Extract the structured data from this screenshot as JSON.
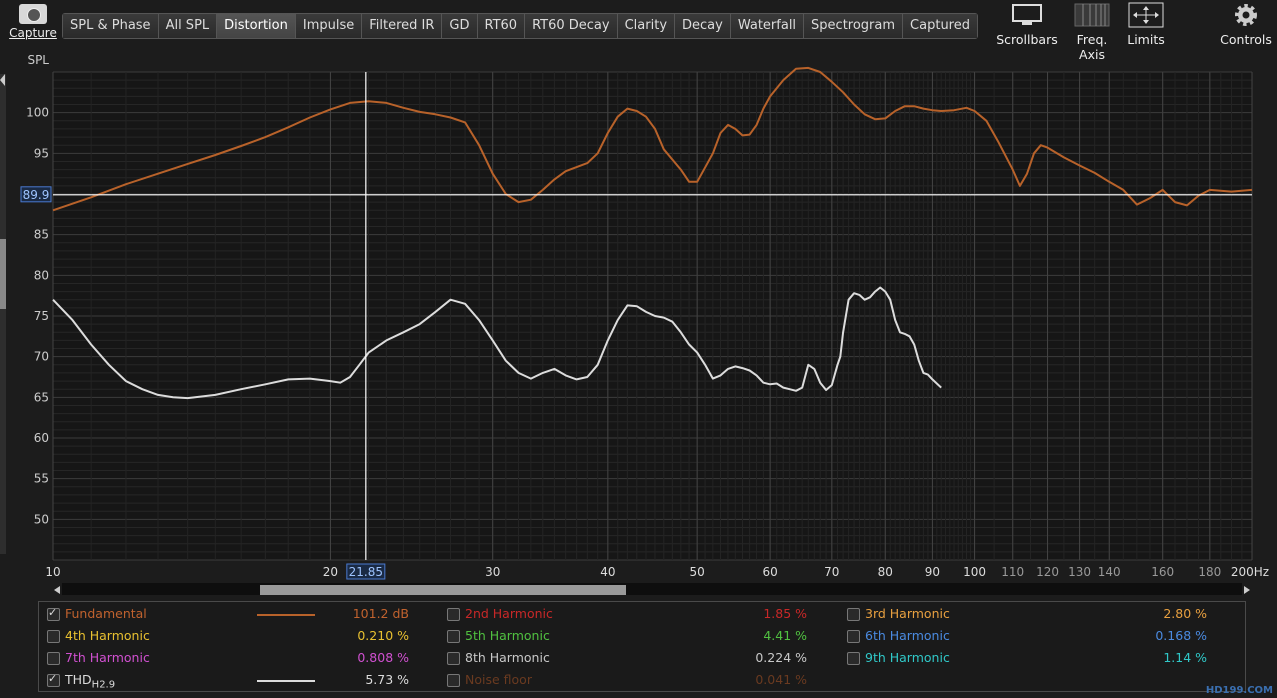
{
  "toolbar": {
    "capture_label": "Capture",
    "tabs": [
      "SPL & Phase",
      "All SPL",
      "Distortion",
      "Impulse",
      "Filtered IR",
      "GD",
      "RT60",
      "RT60 Decay",
      "Clarity",
      "Decay",
      "Waterfall",
      "Spectrogram",
      "Captured"
    ],
    "active_tab": "Distortion",
    "scrollbars_label": "Scrollbars",
    "freq_axis_label": "Freq. Axis",
    "limits_label": "Limits",
    "controls_label": "Controls"
  },
  "chart_data": {
    "type": "line",
    "ylabel": "SPL",
    "xscale": "log",
    "xlim": [
      10,
      200
    ],
    "ylim": [
      45,
      105
    ],
    "yticks": [
      50,
      55,
      60,
      65,
      70,
      75,
      80,
      85,
      90,
      95,
      100
    ],
    "xticks": [
      {
        "v": 10,
        "label": "10"
      },
      {
        "v": 20,
        "label": "20"
      },
      {
        "v": 30,
        "label": "30"
      },
      {
        "v": 40,
        "label": "40"
      },
      {
        "v": 50,
        "label": "50"
      },
      {
        "v": 60,
        "label": "60"
      },
      {
        "v": 70,
        "label": "70"
      },
      {
        "v": 80,
        "label": "80"
      },
      {
        "v": 90,
        "label": "90"
      },
      {
        "v": 100,
        "label": "100"
      },
      {
        "v": 110,
        "label": "110"
      },
      {
        "v": 120,
        "label": "120"
      },
      {
        "v": 130,
        "label": "130"
      },
      {
        "v": 140,
        "label": "140"
      },
      {
        "v": 160,
        "label": "160"
      },
      {
        "v": 180,
        "label": "180"
      },
      {
        "v": 200,
        "label": "200Hz"
      }
    ],
    "cursor": {
      "x": 21.85,
      "x_label": "21.85",
      "y": 89.9,
      "y_label": "89.9"
    },
    "series": [
      {
        "name": "Fundamental",
        "color": "#b8622a",
        "points": [
          [
            10,
            88
          ],
          [
            11,
            89.6
          ],
          [
            12,
            91.2
          ],
          [
            13,
            92.5
          ],
          [
            14,
            93.7
          ],
          [
            15,
            94.8
          ],
          [
            16,
            95.9
          ],
          [
            17,
            97
          ],
          [
            18,
            98.2
          ],
          [
            19,
            99.4
          ],
          [
            20,
            100.4
          ],
          [
            21,
            101.2
          ],
          [
            22,
            101.4
          ],
          [
            23,
            101.2
          ],
          [
            24,
            100.6
          ],
          [
            25,
            100.1
          ],
          [
            26,
            99.8
          ],
          [
            27,
            99.4
          ],
          [
            28,
            98.8
          ],
          [
            29,
            96
          ],
          [
            30,
            92.5
          ],
          [
            31,
            90
          ],
          [
            32,
            89
          ],
          [
            33,
            89.3
          ],
          [
            34,
            90.5
          ],
          [
            35,
            91.8
          ],
          [
            36,
            92.8
          ],
          [
            38,
            93.8
          ],
          [
            39,
            95
          ],
          [
            40,
            97.5
          ],
          [
            41,
            99.5
          ],
          [
            42,
            100.5
          ],
          [
            43,
            100.2
          ],
          [
            44,
            99.5
          ],
          [
            45,
            98
          ],
          [
            46,
            95.5
          ],
          [
            48,
            93
          ],
          [
            49,
            91.5
          ],
          [
            50,
            91.5
          ],
          [
            52,
            95
          ],
          [
            53,
            97.5
          ],
          [
            54,
            98.5
          ],
          [
            55,
            98
          ],
          [
            56,
            97.2
          ],
          [
            57,
            97.3
          ],
          [
            58,
            98.5
          ],
          [
            59,
            100.5
          ],
          [
            60,
            102
          ],
          [
            62,
            104
          ],
          [
            64,
            105.4
          ],
          [
            66,
            105.5
          ],
          [
            68,
            105
          ],
          [
            70,
            103.8
          ],
          [
            72,
            102.5
          ],
          [
            74,
            101
          ],
          [
            76,
            99.8
          ],
          [
            78,
            99.2
          ],
          [
            80,
            99.3
          ],
          [
            82,
            100.2
          ],
          [
            84,
            100.8
          ],
          [
            86,
            100.8
          ],
          [
            88,
            100.5
          ],
          [
            90,
            100.3
          ],
          [
            92,
            100.2
          ],
          [
            95,
            100.3
          ],
          [
            98,
            100.6
          ],
          [
            100,
            100.2
          ],
          [
            103,
            99
          ],
          [
            106,
            96.5
          ],
          [
            110,
            93
          ],
          [
            112,
            91
          ],
          [
            114,
            92.5
          ],
          [
            116,
            95
          ],
          [
            118,
            96
          ],
          [
            120,
            95.7
          ],
          [
            125,
            94.5
          ],
          [
            130,
            93.5
          ],
          [
            135,
            92.6
          ],
          [
            140,
            91.5
          ],
          [
            145,
            90.5
          ],
          [
            150,
            88.7
          ],
          [
            155,
            89.5
          ],
          [
            160,
            90.5
          ],
          [
            165,
            89
          ],
          [
            170,
            88.6
          ],
          [
            175,
            89.8
          ],
          [
            180,
            90.5
          ],
          [
            190,
            90.3
          ],
          [
            200,
            90.5
          ]
        ]
      },
      {
        "name": "THD",
        "color": "#dcdcdc",
        "points": [
          [
            10,
            77
          ],
          [
            10.5,
            74.5
          ],
          [
            11,
            71.5
          ],
          [
            11.5,
            69
          ],
          [
            12,
            67
          ],
          [
            12.5,
            66
          ],
          [
            13,
            65.3
          ],
          [
            13.5,
            65
          ],
          [
            14,
            64.9
          ],
          [
            15,
            65.3
          ],
          [
            16,
            66
          ],
          [
            17,
            66.6
          ],
          [
            18,
            67.2
          ],
          [
            19,
            67.3
          ],
          [
            20,
            67
          ],
          [
            20.5,
            66.8
          ],
          [
            21,
            67.5
          ],
          [
            21.5,
            69
          ],
          [
            22,
            70.5
          ],
          [
            23,
            72
          ],
          [
            24,
            73
          ],
          [
            25,
            74
          ],
          [
            26,
            75.5
          ],
          [
            27,
            77
          ],
          [
            28,
            76.5
          ],
          [
            29,
            74.5
          ],
          [
            30,
            72
          ],
          [
            31,
            69.5
          ],
          [
            32,
            68
          ],
          [
            33,
            67.3
          ],
          [
            34,
            68
          ],
          [
            35,
            68.5
          ],
          [
            36,
            67.7
          ],
          [
            37,
            67.2
          ],
          [
            38,
            67.5
          ],
          [
            39,
            69
          ],
          [
            40,
            72
          ],
          [
            41,
            74.5
          ],
          [
            42,
            76.3
          ],
          [
            43,
            76.2
          ],
          [
            44,
            75.5
          ],
          [
            45,
            75
          ],
          [
            46,
            74.8
          ],
          [
            47,
            74.3
          ],
          [
            48,
            73
          ],
          [
            49,
            71.5
          ],
          [
            50,
            70.5
          ],
          [
            51,
            69
          ],
          [
            52,
            67.3
          ],
          [
            53,
            67.7
          ],
          [
            54,
            68.5
          ],
          [
            55,
            68.8
          ],
          [
            56,
            68.6
          ],
          [
            57,
            68.3
          ],
          [
            58,
            67.7
          ],
          [
            59,
            66.8
          ],
          [
            60,
            66.6
          ],
          [
            61,
            66.7
          ],
          [
            62,
            66.2
          ],
          [
            63,
            66
          ],
          [
            64,
            65.8
          ],
          [
            65,
            66.2
          ],
          [
            66,
            69
          ],
          [
            67,
            68.5
          ],
          [
            68,
            66.8
          ],
          [
            69,
            65.9
          ],
          [
            70,
            66.5
          ],
          [
            71,
            69
          ],
          [
            71.5,
            70
          ],
          [
            72,
            73
          ],
          [
            73,
            77
          ],
          [
            74,
            77.8
          ],
          [
            75,
            77.6
          ],
          [
            76,
            77
          ],
          [
            77,
            77.3
          ],
          [
            78,
            78
          ],
          [
            79,
            78.5
          ],
          [
            80,
            78
          ],
          [
            81,
            77
          ],
          [
            82,
            74.5
          ],
          [
            83,
            73
          ],
          [
            84,
            72.8
          ],
          [
            85,
            72.5
          ],
          [
            86,
            71.5
          ],
          [
            87,
            69.5
          ],
          [
            88,
            68
          ],
          [
            89,
            67.8
          ],
          [
            90,
            67.2
          ],
          [
            92,
            66.2
          ]
        ]
      }
    ]
  },
  "legend": {
    "items": [
      {
        "label": "Fundamental",
        "value": "101.2 dB",
        "color": "#c0622e",
        "checked": true,
        "swatch": "#b8622a"
      },
      {
        "label": "2nd Harmonic",
        "value": "1.85 %",
        "color": "#c82828",
        "checked": false
      },
      {
        "label": "3rd Harmonic",
        "value": "2.80 %",
        "color": "#e8a040",
        "checked": false
      },
      {
        "label": "4th Harmonic",
        "value": "0.210 %",
        "color": "#e8c030",
        "checked": false
      },
      {
        "label": "5th Harmonic",
        "value": "4.41 %",
        "color": "#50c040",
        "checked": false
      },
      {
        "label": "6th Harmonic",
        "value": "0.168 %",
        "color": "#4a8ae0",
        "checked": false
      },
      {
        "label": "7th Harmonic",
        "value": "0.808 %",
        "color": "#d050d0",
        "checked": false
      },
      {
        "label": "8th Harmonic",
        "value": "0.224 %",
        "color": "#c8c8c8",
        "checked": false
      },
      {
        "label": "9th Harmonic",
        "value": "1.14 %",
        "color": "#30c8c8",
        "checked": false
      },
      {
        "label": "THD",
        "sub": "H2.9",
        "value": "5.73 %",
        "color": "#dcdcdc",
        "checked": true,
        "swatch": "#dcdcdc"
      },
      {
        "label": "Noise floor",
        "value": "0.041 %",
        "color": "#6a3a20",
        "checked": false
      }
    ]
  },
  "watermark": "HD199.COM"
}
